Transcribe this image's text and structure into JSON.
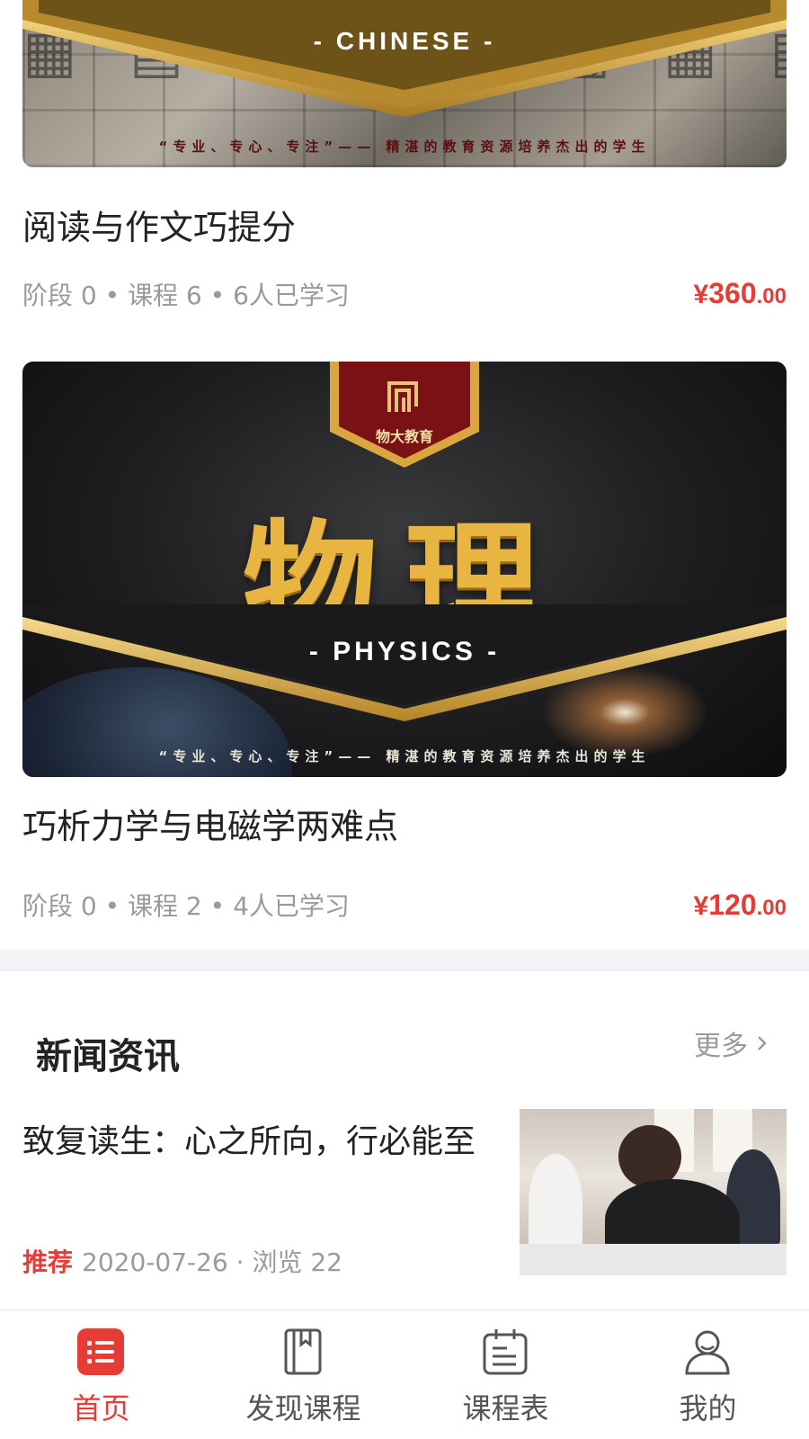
{
  "courses": [
    {
      "banner": {
        "subject_en": "- CHINESE -",
        "slogan": "“专业、专心、专注”—— 精湛的教育资源培养杰出的学生"
      },
      "title": "阅读与作文巧提分",
      "meta": "阶段 0 • 课程 6 • 6人已学习",
      "price": {
        "currency": "¥",
        "integer": "360",
        "decimal": ".00"
      }
    },
    {
      "banner": {
        "brand": "物大教育",
        "subject_cn": "物理",
        "subject_en": "- PHYSICS -",
        "slogan": "“专业、专心、专注”—— 精湛的教育资源培养杰出的学生"
      },
      "title": "巧析力学与电磁学两难点",
      "meta": "阶段 0 • 课程 2 • 4人已学习",
      "price": {
        "currency": "¥",
        "integer": "120",
        "decimal": ".00"
      }
    }
  ],
  "news": {
    "section_title": "新闻资讯",
    "more_label": "更多",
    "items": [
      {
        "title": "致复读生：心之所向，行必能至",
        "tag": "推荐",
        "meta": "2020-07-26 · 浏览 22"
      }
    ]
  },
  "tabbar": {
    "items": [
      {
        "label": "首页",
        "icon": "home-list-icon",
        "active": true
      },
      {
        "label": "发现课程",
        "icon": "book-icon",
        "active": false
      },
      {
        "label": "课程表",
        "icon": "schedule-icon",
        "active": false
      },
      {
        "label": "我的",
        "icon": "user-icon",
        "active": false
      }
    ]
  },
  "colors": {
    "accent": "#e63c36",
    "text_primary": "#222222",
    "text_secondary": "#9a9a9a",
    "section_gap": "#f1f3f6",
    "gold": "#e8b640"
  }
}
